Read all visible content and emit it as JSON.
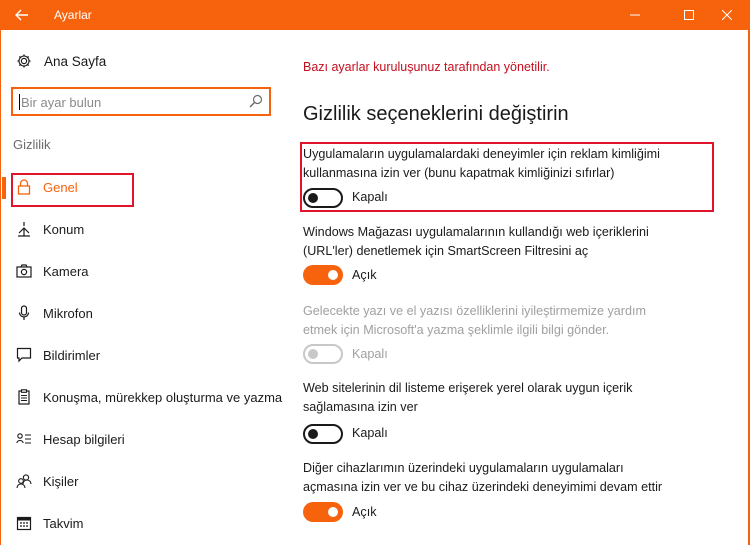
{
  "window": {
    "title": "Ayarlar",
    "accent": "#f7630c",
    "alert_color": "#c50f1f"
  },
  "sidebar": {
    "home_label": "Ana Sayfa",
    "search_placeholder": "Bir ayar bulun",
    "section_label": "Gizlilik",
    "items": [
      {
        "label": "Genel",
        "icon": "lock-icon",
        "selected": true
      },
      {
        "label": "Konum",
        "icon": "location-icon"
      },
      {
        "label": "Kamera",
        "icon": "camera-icon"
      },
      {
        "label": "Mikrofon",
        "icon": "microphone-icon"
      },
      {
        "label": "Bildirimler",
        "icon": "notification-icon"
      },
      {
        "label": "Konuşma, mürekkep oluşturma ve yazma",
        "icon": "speech-icon"
      },
      {
        "label": "Hesap bilgileri",
        "icon": "account-info-icon"
      },
      {
        "label": "Kişiler",
        "icon": "people-icon"
      },
      {
        "label": "Takvim",
        "icon": "calendar-icon"
      }
    ]
  },
  "main": {
    "org_notice": "Bazı ayarlar kuruluşunuz tarafından yönetilir.",
    "heading": "Gizlilik seçeneklerini değiştirin",
    "options": [
      {
        "text_line1": "Uygulamaların uygulamalardaki deneyimler için reklam kimliğimi",
        "text_line2": "kullanmasına izin ver (bunu kapatmak kimliğinizi sıfırlar)",
        "state": "Kapalı",
        "on": false,
        "enabled": true
      },
      {
        "text_line1": "Windows Mağazası uygulamalarının kullandığı web içeriklerini",
        "text_line2": "(URL'ler) denetlemek için SmartScreen Filtresini aç",
        "state": "Açık",
        "on": true,
        "enabled": true
      },
      {
        "text_line1": "Gelecekte yazı ve el yazısı özelliklerini iyileştirmemize yardım",
        "text_line2": "etmek için Microsoft'a yazma şeklimle ilgili bilgi gönder.",
        "state": "Kapalı",
        "on": false,
        "enabled": false
      },
      {
        "text_line1": "Web sitelerinin dil listeme erişerek yerel olarak uygun içerik",
        "text_line2": "sağlamasına izin ver",
        "state": "Kapalı",
        "on": false,
        "enabled": true
      },
      {
        "text_line1": "Diğer cihazlarımın üzerindeki uygulamaların uygulamaları",
        "text_line2": "açmasına izin ver ve bu cihaz üzerindeki deneyimimi devam ettir",
        "state": "Açık",
        "on": true,
        "enabled": true
      }
    ]
  }
}
